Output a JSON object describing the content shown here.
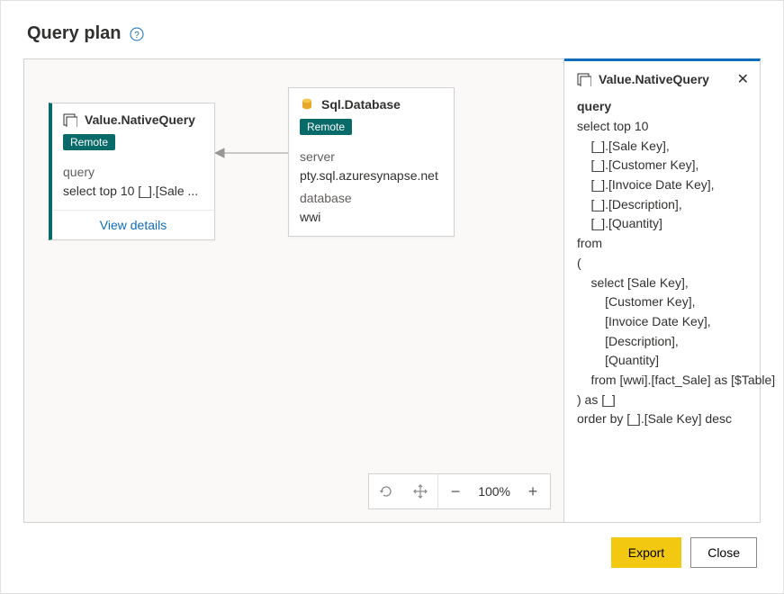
{
  "header": {
    "title": "Query plan"
  },
  "nodes": {
    "nativeQuery": {
      "title": "Value.NativeQuery",
      "badge": "Remote",
      "keys": {
        "query_label": "query",
        "query_preview": "select top 10 [_].[Sale ..."
      },
      "view_details": "View details"
    },
    "sqlDatabase": {
      "title": "Sql.Database",
      "badge": "Remote",
      "keys": {
        "server_label": "server",
        "server_value": "pty.sql.azuresynapse.net",
        "database_label": "database",
        "database_value": "wwi"
      }
    }
  },
  "toolbar": {
    "zoom": "100%"
  },
  "detail": {
    "title": "Value.NativeQuery",
    "section_label": "query",
    "query": "select top 10\n    [_].[Sale Key],\n    [_].[Customer Key],\n    [_].[Invoice Date Key],\n    [_].[Description],\n    [_].[Quantity]\nfrom\n(\n    select [Sale Key],\n        [Customer Key],\n        [Invoice Date Key],\n        [Description],\n        [Quantity]\n    from [wwi].[fact_Sale] as [$Table]\n) as [_]\norder by [_].[Sale Key] desc"
  },
  "footer": {
    "export": "Export",
    "close": "Close"
  }
}
